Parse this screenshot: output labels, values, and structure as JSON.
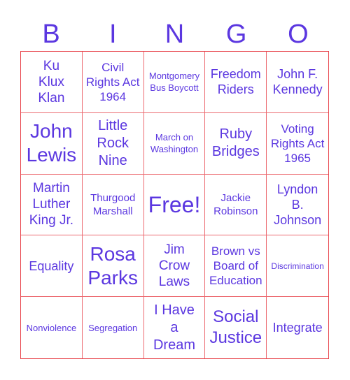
{
  "title_letters": [
    "B",
    "I",
    "N",
    "G",
    "O"
  ],
  "colors": {
    "text": "#5b37e0",
    "grid_line": "#e8424a"
  },
  "cells": [
    {
      "label": "Ku Klux Klan"
    },
    {
      "label": "Civil Rights Act 1964"
    },
    {
      "label": "Montgomery Bus Boycott"
    },
    {
      "label": "Freedom Riders"
    },
    {
      "label": "John F. Kennedy"
    },
    {
      "label": "John Lewis"
    },
    {
      "label": "Little Rock Nine"
    },
    {
      "label": "March on Washington"
    },
    {
      "label": "Ruby Bridges"
    },
    {
      "label": "Voting Rights Act 1965"
    },
    {
      "label": "Martin Luther King Jr."
    },
    {
      "label": "Thurgood Marshall"
    },
    {
      "label": "Free!"
    },
    {
      "label": "Jackie Robinson"
    },
    {
      "label": "Lyndon B. Johnson"
    },
    {
      "label": "Equality"
    },
    {
      "label": "Rosa Parks"
    },
    {
      "label": "Jim Crow Laws"
    },
    {
      "label": "Brown vs Board of Education"
    },
    {
      "label": "Discrimination"
    },
    {
      "label": "Nonviolence"
    },
    {
      "label": "Segregation"
    },
    {
      "label": "I Have a Dream"
    },
    {
      "label": "Social Justice"
    },
    {
      "label": "Integrate"
    }
  ]
}
